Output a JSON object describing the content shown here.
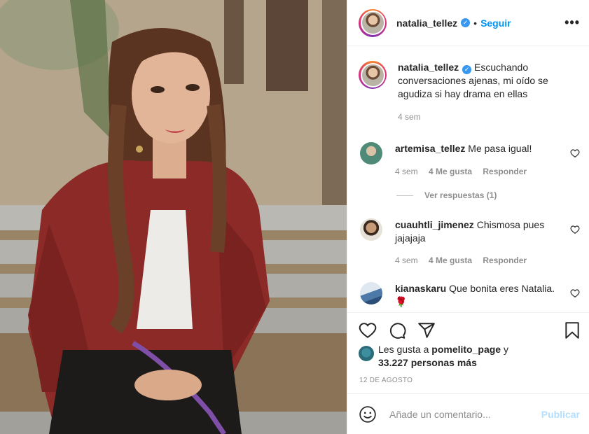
{
  "post": {
    "author": "natalia_tellez",
    "verified_mark": "✓",
    "separator": "•",
    "follow_label": "Seguir",
    "more_label": "•••",
    "caption": "Escuchando conversaciones ajenas, mi oído se agudiza si hay drama en ellas",
    "caption_time": "4 sem"
  },
  "comments": [
    {
      "user": "artemisa_tellez",
      "text": "Me pasa igual!",
      "time": "4 sem",
      "likes": "4 Me gusta",
      "reply_label": "Responder",
      "view_replies": "Ver respuestas (1)",
      "avatar_color": "#5f9a86"
    },
    {
      "user": "cuauhtli_jimenez",
      "text": "Chismosa pues jajajaja",
      "time": "4 sem",
      "likes": "4 Me gusta",
      "reply_label": "Responder",
      "avatar_color": "#7a5a44"
    },
    {
      "user": "kianaskaru",
      "text": "Que bonita eres Natalia.🌹",
      "avatar_color": "#6b8fb3"
    }
  ],
  "likes": {
    "prefix": "Les gusta a",
    "user": "pomelito_page",
    "conjunction": "y",
    "others": "33.227 personas más"
  },
  "date": "12 DE AGOSTO",
  "add_comment": {
    "placeholder": "Añade un comentario...",
    "publish_label": "Publicar"
  },
  "icons": {
    "like": "heart-icon",
    "comment": "comment-icon",
    "share": "paper-plane-icon",
    "save": "bookmark-icon",
    "emoji": "emoji-icon",
    "comment_like": "heart-icon"
  },
  "colors": {
    "link_blue": "#0095f6",
    "publish_disabled": "#b2dffc",
    "muted": "#8e8e8e",
    "jacket_red": "#8c2a27"
  }
}
